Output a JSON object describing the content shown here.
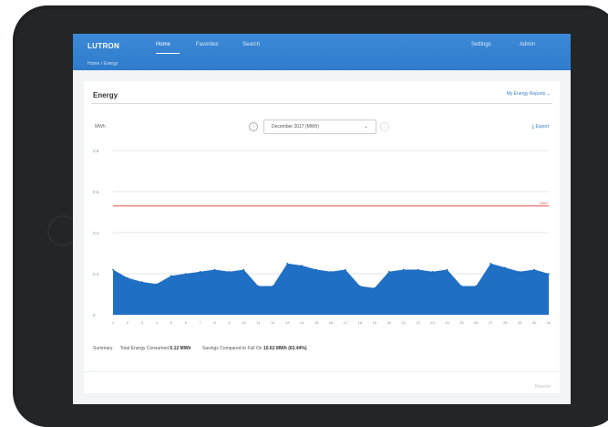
{
  "app": {
    "logo": "LUTRON",
    "nav": [
      "Home",
      "Favorites",
      "Search"
    ],
    "nav_right": [
      "Settings",
      "Admin"
    ],
    "breadcrumb": "Home / Energy"
  },
  "card": {
    "title": "Energy",
    "reports_link": "My Energy Reports ⌄",
    "unit_label": "MWh",
    "period_select": "December 2017 (MWh)",
    "select_caret": "⌄",
    "export_label": "Export",
    "export_icon": "⤓",
    "prev_icon": "‹",
    "next_icon": "›"
  },
  "summary": {
    "label": "Summary",
    "total_label": "Total Energy Consumed",
    "total_value": "6.12 MWh",
    "savings_label": "Savings Compared to Full On",
    "savings_value": "10.62 MWh (63.44%)"
  },
  "footer": {
    "text": "Reports"
  },
  "colors": {
    "bar": "#1f6fc4",
    "baseline": "#e2514c",
    "header": "#3a86d4"
  },
  "chart_data": {
    "type": "area",
    "x": [
      1,
      2,
      3,
      4,
      5,
      6,
      7,
      8,
      9,
      10,
      11,
      12,
      13,
      14,
      15,
      16,
      17,
      18,
      19,
      20,
      21,
      22,
      23,
      24,
      25,
      26,
      27,
      28,
      29,
      30,
      31
    ],
    "values": [
      0.22,
      0.18,
      0.16,
      0.15,
      0.19,
      0.2,
      0.21,
      0.22,
      0.21,
      0.22,
      0.14,
      0.14,
      0.25,
      0.24,
      0.22,
      0.21,
      0.22,
      0.14,
      0.13,
      0.21,
      0.22,
      0.22,
      0.21,
      0.22,
      0.14,
      0.14,
      0.25,
      0.23,
      0.21,
      0.22,
      0.2
    ],
    "y_ticks": [
      "0",
      "0.2",
      "0.4",
      "0.6",
      "0.8"
    ],
    "ylim": [
      0,
      0.8
    ],
    "baseline": 0.53,
    "baseline_label": "MAX",
    "ylabel": "MWh",
    "grid": true
  }
}
